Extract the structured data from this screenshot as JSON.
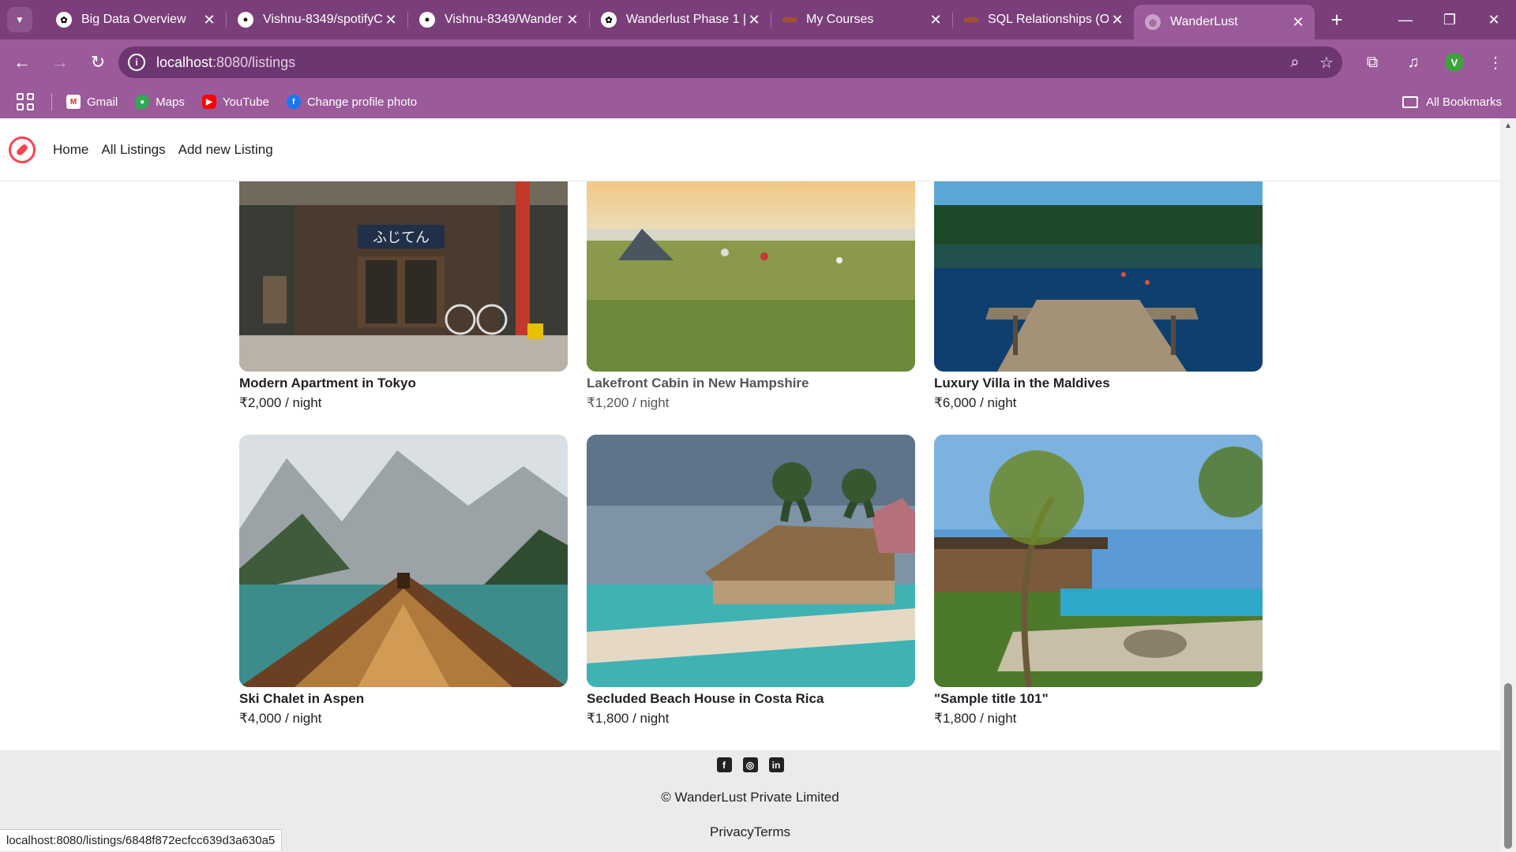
{
  "browser": {
    "tabs": [
      {
        "title": "Big Data Overview",
        "favicon": "openai-icon"
      },
      {
        "title": "Vishnu-8349/spotifyC",
        "favicon": "github-icon"
      },
      {
        "title": "Vishnu-8349/Wander",
        "favicon": "github-icon"
      },
      {
        "title": "Wanderlust Phase 1 |",
        "favicon": "openai-icon"
      },
      {
        "title": "My Courses",
        "favicon": "course-icon"
      },
      {
        "title": "SQL Relationships (O",
        "favicon": "course-icon"
      },
      {
        "title": "WanderLust",
        "favicon": "globe-icon",
        "active": true
      }
    ],
    "url_host": "localhost",
    "url_path": ":8080/listings",
    "bookmarks": [
      {
        "label": "Gmail",
        "icon": "gmail-icon"
      },
      {
        "label": "Maps",
        "icon": "maps-icon"
      },
      {
        "label": "YouTube",
        "icon": "youtube-icon"
      },
      {
        "label": "Change profile photo",
        "icon": "facebook-icon"
      }
    ],
    "all_bookmarks": "All Bookmarks",
    "profile_initial": "V",
    "status_url": "localhost:8080/listings/6848f872ecfcc639d3a630a5"
  },
  "site": {
    "nav": {
      "home": "Home",
      "all_listings": "All Listings",
      "add_listing": "Add new Listing"
    },
    "listings": [
      {
        "title": "Modern Apartment in Tokyo",
        "price": "₹2,000 / night"
      },
      {
        "title": "Lakefront Cabin in New Hampshire",
        "price": "₹1,200 / night"
      },
      {
        "title": "Luxury Villa in the Maldives",
        "price": "₹6,000 / night"
      },
      {
        "title": "Ski Chalet in Aspen",
        "price": "₹4,000 / night"
      },
      {
        "title": "Secluded Beach House in Costa Rica",
        "price": "₹1,800 / night"
      },
      {
        "title": "\"Sample title 101\"",
        "price": "₹1,800 / night"
      }
    ],
    "footer": {
      "copyright": "© WanderLust Private Limited",
      "privacy": "Privacy",
      "terms": "Terms"
    }
  },
  "colors": {
    "brand": "#fe424d",
    "chrome_dark": "#7a3f7a",
    "chrome": "#9b5a99"
  }
}
